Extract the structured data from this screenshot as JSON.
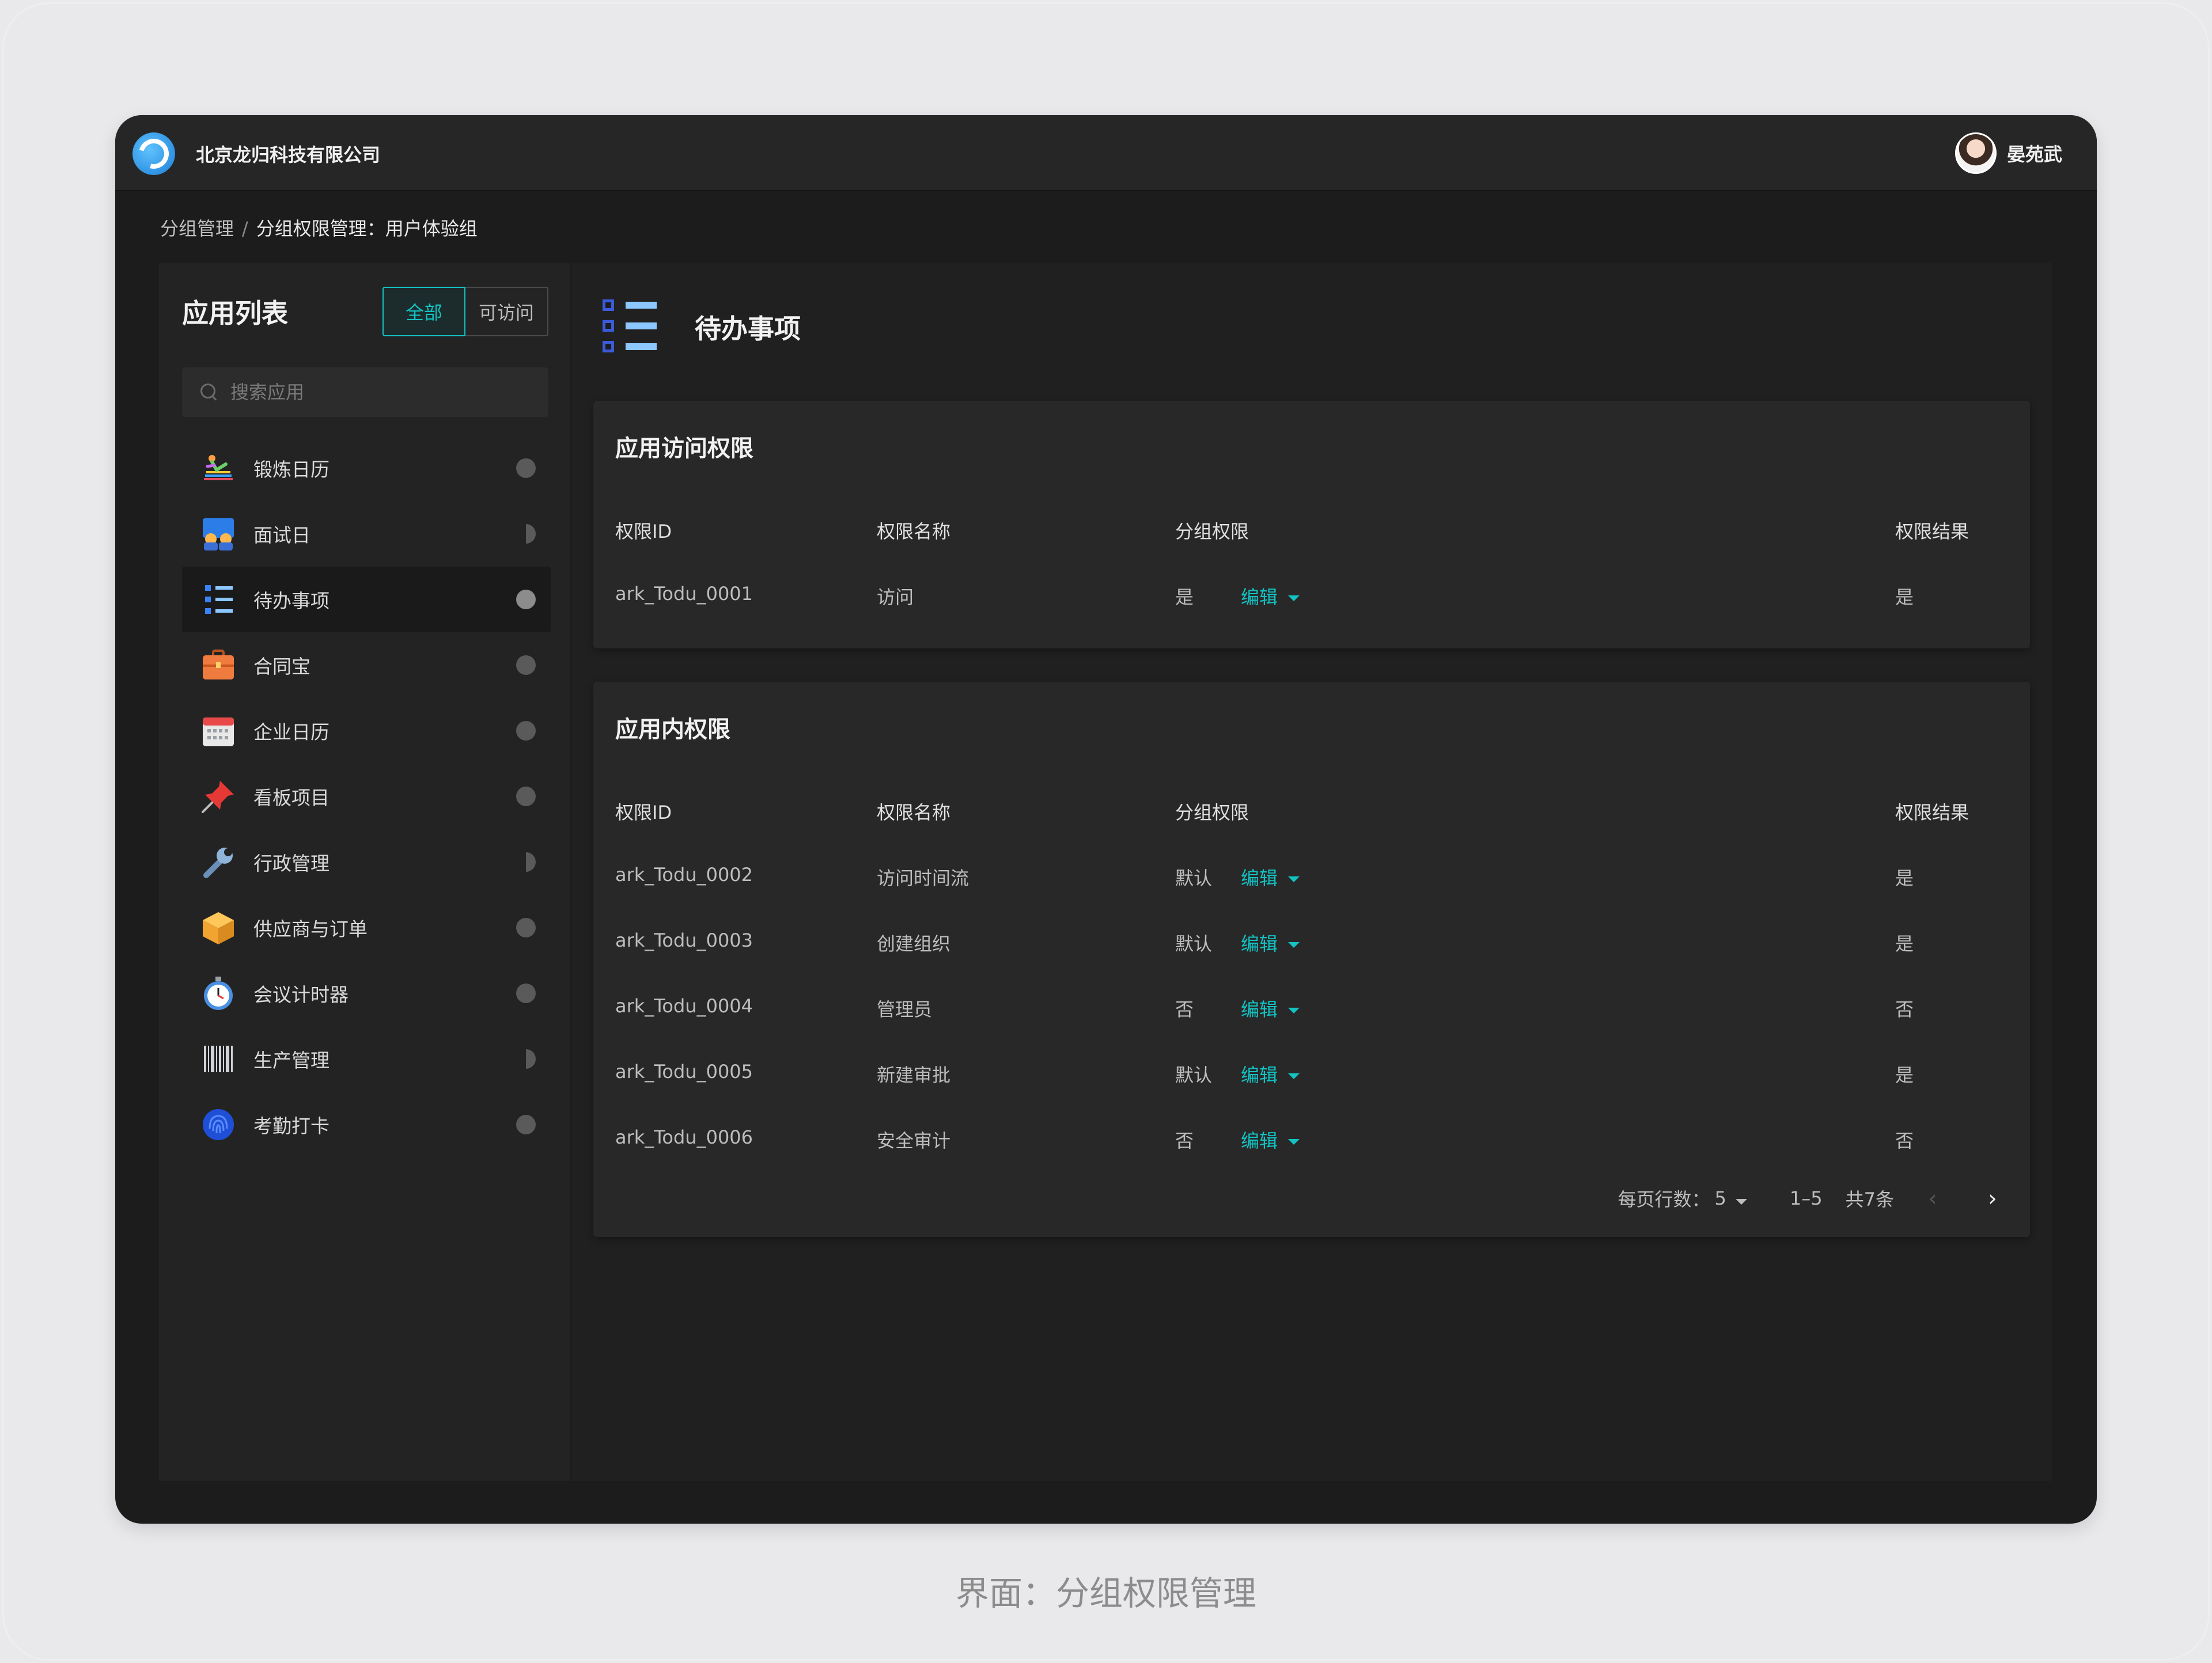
{
  "header": {
    "company": "北京龙归科技有限公司",
    "username": "晏苑武"
  },
  "breadcrumb": {
    "parent": "分组管理",
    "separator": "/",
    "current": "分组权限管理：用户体验组"
  },
  "sidebar": {
    "title": "应用列表",
    "filter_all": "全部",
    "filter_accessible": "可访问",
    "search_placeholder": "搜索应用",
    "items": [
      {
        "label": "锻炼日历",
        "icon": "exercise-icon",
        "status": "full"
      },
      {
        "label": "面试日",
        "icon": "interview-icon",
        "status": "half"
      },
      {
        "label": "待办事项",
        "icon": "todo-list-icon",
        "status": "full",
        "active": true
      },
      {
        "label": "合同宝",
        "icon": "briefcase-icon",
        "status": "full"
      },
      {
        "label": "企业日历",
        "icon": "calendar-icon",
        "status": "full"
      },
      {
        "label": "看板项目",
        "icon": "pushpin-icon",
        "status": "full"
      },
      {
        "label": "行政管理",
        "icon": "wrench-icon",
        "status": "half"
      },
      {
        "label": "供应商与订单",
        "icon": "package-icon",
        "status": "full"
      },
      {
        "label": "会议计时器",
        "icon": "stopwatch-icon",
        "status": "full"
      },
      {
        "label": "生产管理",
        "icon": "barcode-icon",
        "status": "half"
      },
      {
        "label": "考勤打卡",
        "icon": "fingerprint-icon",
        "status": "full"
      }
    ]
  },
  "main": {
    "title": "待办事项",
    "columns": {
      "id": "权限ID",
      "name": "权限名称",
      "group": "分组权限",
      "result": "权限结果"
    },
    "edit_label": "编辑",
    "access_card": {
      "title": "应用访问权限",
      "rows": [
        {
          "id": "ark_Todu_0001",
          "name": "访问",
          "group": "是",
          "result": "是"
        }
      ]
    },
    "inapp_card": {
      "title": "应用内权限",
      "rows": [
        {
          "id": "ark_Todu_0002",
          "name": "访问时间流",
          "group": "默认",
          "result": "是"
        },
        {
          "id": "ark_Todu_0003",
          "name": "创建组织",
          "group": "默认",
          "result": "是"
        },
        {
          "id": "ark_Todu_0004",
          "name": "管理员",
          "group": "否",
          "result": "否"
        },
        {
          "id": "ark_Todu_0005",
          "name": "新建审批",
          "group": "默认",
          "result": "是"
        },
        {
          "id": "ark_Todu_0006",
          "name": "安全审计",
          "group": "否",
          "result": "否"
        }
      ]
    },
    "pagination": {
      "rows_per_page_label": "每页行数：",
      "rows_per_page": "5",
      "range": "1–5",
      "total": "共7条"
    }
  },
  "caption": "界面：分组权限管理",
  "colors": {
    "accent": "#13c2c2",
    "background": "#1c1c1c",
    "panel": "#282828"
  }
}
